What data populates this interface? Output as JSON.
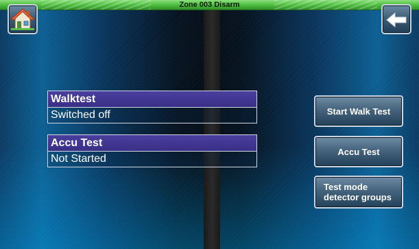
{
  "header": {
    "title": "Zone 003  Disarm"
  },
  "nav": {
    "home_icon": "home-icon",
    "back_icon": "back-arrow-icon"
  },
  "status": {
    "walktest": {
      "label": "Walktest",
      "value": "Switched off"
    },
    "accu_test": {
      "label": "Accu  Test",
      "value": "Not Started"
    }
  },
  "actions": {
    "start_walk_test": "Start Walk Test",
    "accu_test": "Accu  Test",
    "test_mode_groups": "Test mode\ndetector groups"
  },
  "colors": {
    "title_bar": "#4fbf3f",
    "label_header": "#3a2f86",
    "button_face": "#46647d"
  }
}
